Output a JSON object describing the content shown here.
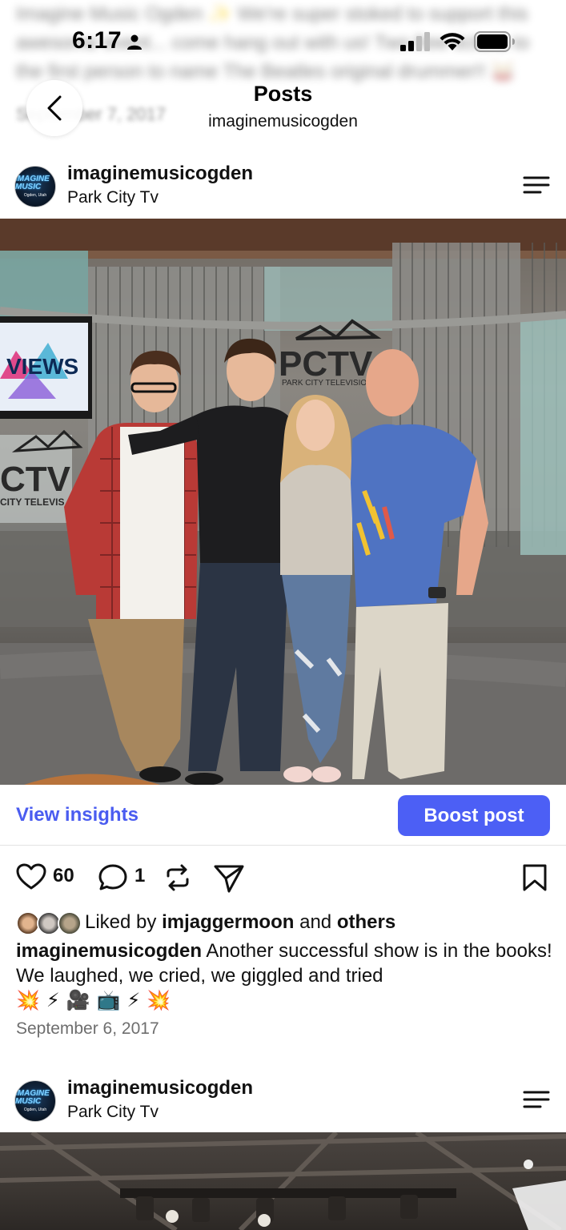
{
  "status_bar": {
    "time": "6:17"
  },
  "background_blurred": {
    "text": "Imagine Music Ogden ✨ We're super stoked to support this awesome event... come hang out with us! Two free tickets to the first person to name The Beatles original drummer!! 🥁",
    "date": "September 7, 2017"
  },
  "header": {
    "title": "Posts",
    "subtitle": "imaginemusicogden"
  },
  "post1": {
    "account": "imaginemusicogden",
    "location": "Park City Tv",
    "avatar_text": "IMAGINE MUSIC",
    "avatar_sub": "Ogden, Utah",
    "photo_signs": {
      "views": "VIEWS",
      "pctv": "PCTV",
      "pctv_sub": "PARK CITY TELEVISION",
      "ctv": "CTV",
      "city_tv": "CITY TELEVIS"
    },
    "insights_label": "View insights",
    "boost_label": "Boost post",
    "likes": "60",
    "comments": "1",
    "liked_by_prefix": "Liked by",
    "liked_by_user": "imjaggermoon",
    "liked_by_and": "and",
    "liked_by_others": "others",
    "caption_user": "imaginemusicogden",
    "caption_text": "Another successful show is in the books! We laughed, we cried, we giggled and tried",
    "caption_emojis": [
      "💥",
      "⚡",
      "🎥",
      "📺",
      "⚡",
      "💥"
    ],
    "date": "September 6, 2017"
  },
  "post2": {
    "account": "imaginemusicogden",
    "location": "Park City Tv",
    "avatar_text": "IMAGINE MUSIC",
    "avatar_sub": "Ogden, Utah"
  },
  "colors": {
    "accent": "#4c5ff5",
    "link": "#4a5cf0",
    "secondary_text": "#6e6e6e"
  },
  "icons": [
    "person-icon",
    "signal-icon",
    "wifi-icon",
    "battery-icon",
    "back-chevron-icon",
    "menu-icon",
    "heart-icon",
    "comment-icon",
    "repost-icon",
    "share-icon",
    "bookmark-icon"
  ]
}
